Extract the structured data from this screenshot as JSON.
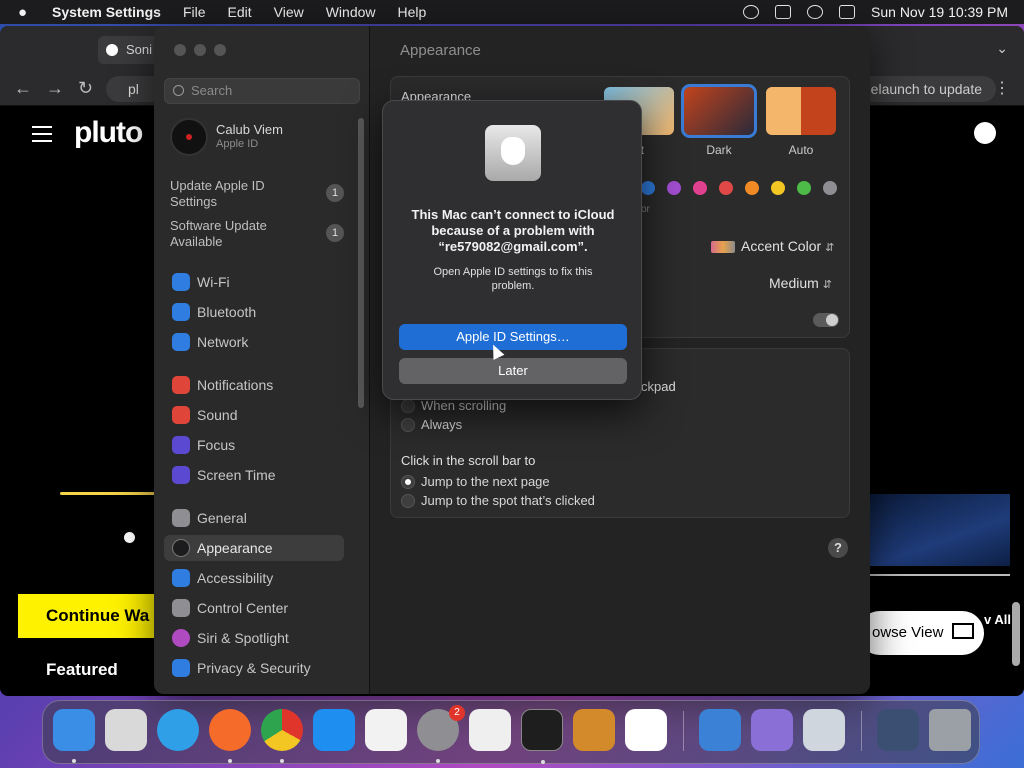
{
  "menubar": {
    "app_name": "System Settings",
    "menus": [
      "File",
      "Edit",
      "View",
      "Window",
      "Help"
    ],
    "datetime": "Sun Nov 19  10:39 PM"
  },
  "browser": {
    "tab_title": "Soni",
    "url_partial": "pl",
    "relaunch_label": "Relaunch to update",
    "logo": "pluto",
    "continue_label": "Continue Wa",
    "featured_label": "Featured",
    "browse_view_label": "owse View",
    "view_all_label": "v All"
  },
  "settings": {
    "search_placeholder": "Search",
    "account": {
      "name": "Calub Viem",
      "subtitle": "Apple ID"
    },
    "notices": [
      {
        "label": "Update Apple ID Settings",
        "count": "1"
      },
      {
        "label": "Software Update Available",
        "count": "1"
      }
    ],
    "sidebar_items": [
      {
        "label": "Wi-Fi",
        "color": "#2f7de1"
      },
      {
        "label": "Bluetooth",
        "color": "#2f7de1"
      },
      {
        "label": "Network",
        "color": "#2f7de1"
      },
      {
        "label": "Notifications",
        "color": "#e0453a"
      },
      {
        "label": "Sound",
        "color": "#e0453a"
      },
      {
        "label": "Focus",
        "color": "#5b4ad1"
      },
      {
        "label": "Screen Time",
        "color": "#5b4ad1"
      },
      {
        "label": "General",
        "color": "#8e8e93"
      },
      {
        "label": "Appearance",
        "color": "#1c1c1e"
      },
      {
        "label": "Accessibility",
        "color": "#2f7de1"
      },
      {
        "label": "Control Center",
        "color": "#8e8e93"
      },
      {
        "label": "Siri & Spotlight",
        "color": "#b04ac0"
      },
      {
        "label": "Privacy & Security",
        "color": "#2f7de1"
      }
    ],
    "active_item": "Appearance",
    "content_title": "Appearance",
    "appearance_label": "Appearance",
    "themes": [
      {
        "label": "nt"
      },
      {
        "label": "Dark"
      },
      {
        "label": "Auto"
      }
    ],
    "accent_colors": [
      "#2f7de1",
      "#a24ed1",
      "#e0418f",
      "#e04848",
      "#f08a24",
      "#f3c623",
      "#4cbb47",
      "#8e8e93"
    ],
    "accent_caption": "or",
    "highlight_select": "Accent Color",
    "sidebar_size_select": "Medium",
    "scroll_partial_label": "ckpad",
    "scroll_options": [
      "When scrolling",
      "Always"
    ],
    "click_label": "Click in the scroll bar to",
    "click_options": [
      "Jump to the next page",
      "Jump to the spot that’s clicked"
    ],
    "help": "?"
  },
  "alert": {
    "title": "This Mac can’t connect to iCloud because of a problem with “re579082@gmail.com”.",
    "message": "Open Apple ID settings to fix this problem.",
    "primary_button": "Apple ID Settings…",
    "secondary_button": "Later"
  },
  "dock": {
    "apps": [
      {
        "name": "finder-icon",
        "color": "#3a8ee6"
      },
      {
        "name": "launchpad-icon",
        "color": "#d9d9d9"
      },
      {
        "name": "safari-icon",
        "color": "#2f9fe8"
      },
      {
        "name": "firefox-icon",
        "color": "#f46b2a"
      },
      {
        "name": "chrome-icon",
        "color": "#ffffff"
      },
      {
        "name": "app-store-icon",
        "color": "#1f8ef1"
      },
      {
        "name": "freeform-icon",
        "color": "#f2f2f2"
      },
      {
        "name": "system-settings-icon",
        "color": "#8e8e93"
      },
      {
        "name": "textedit-icon",
        "color": "#efefef"
      },
      {
        "name": "terminal-icon",
        "color": "#1e1e1e"
      },
      {
        "name": "garageband-icon",
        "color": "#d38a2a"
      },
      {
        "name": "vscode-icon",
        "color": "#ffffff"
      },
      {
        "name": "icloud-weather-icon",
        "color": "#3b82d6"
      },
      {
        "name": "archive-icon",
        "color": "#8a6fd6"
      },
      {
        "name": "preview-icon",
        "color": "#cfd6de"
      },
      {
        "name": "downloads-icon",
        "color": "#3b4f73"
      },
      {
        "name": "trash-icon",
        "color": "#9aa0a6"
      }
    ],
    "settings_badge": "2"
  }
}
